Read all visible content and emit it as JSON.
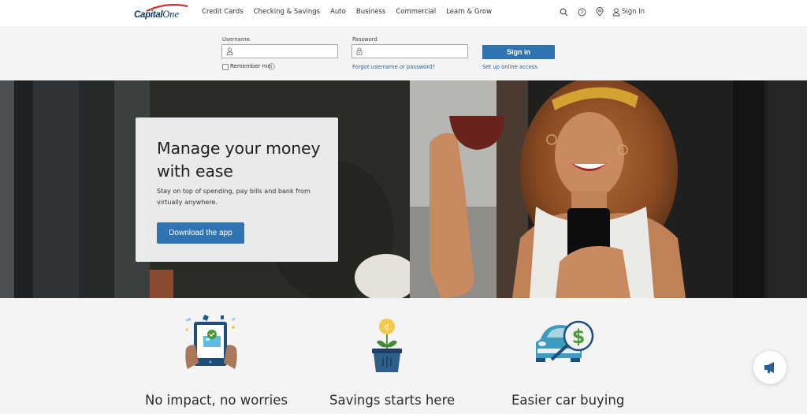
{
  "header": {
    "brand": {
      "part1": "Capital",
      "part2": "One"
    },
    "nav": [
      "Credit Cards",
      "Checking & Savings",
      "Auto",
      "Business",
      "Commercial",
      "Learn & Grow"
    ],
    "icons": [
      "search-icon",
      "help-icon",
      "location-icon",
      "user-icon"
    ],
    "sign_in_label": "Sign In"
  },
  "login": {
    "username_label": "Username",
    "username_value": "",
    "password_label": "Password",
    "password_value": "",
    "remember_label": "Remember me",
    "remember_checked": false,
    "forgot_link": "Forgot username or password?",
    "sign_in_button": "Sign in",
    "setup_link": "Set up online access",
    "accent_color": "#2f73b0"
  },
  "hero": {
    "title": "Manage your money with ease",
    "subtitle": "Stay on top of spending, pay bills and bank from virtually anywhere.",
    "cta": "Download the app",
    "image_description": "Smiling woman with curly hair and yellow headband holding a coffee cup and looking at her phone"
  },
  "features": [
    {
      "icon": "tablet-checkmark-icon",
      "title": "No impact, no worries"
    },
    {
      "icon": "coin-plant-icon",
      "title": "Savings starts here"
    },
    {
      "icon": "car-magnifier-icon",
      "title": "Easier car buying"
    }
  ],
  "fab": {
    "icon": "megaphone-icon"
  }
}
